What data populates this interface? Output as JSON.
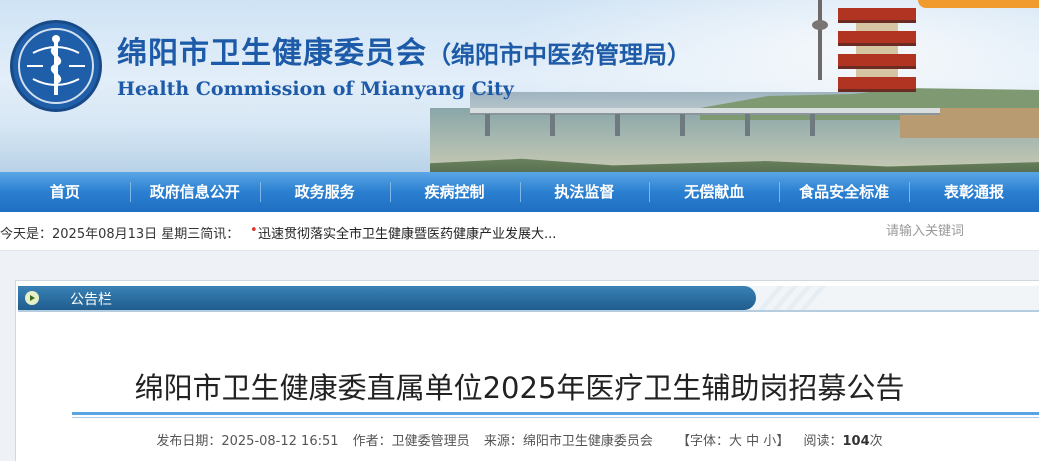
{
  "header": {
    "title_cn": "绵阳市卫生健康委员会",
    "title_cn_sub": "（绵阳市中医药管理局）",
    "title_en": "Health Commission of Mianyang City"
  },
  "nav": {
    "items": [
      {
        "label": "首页"
      },
      {
        "label": "政府信息公开"
      },
      {
        "label": "政务服务"
      },
      {
        "label": "疾病控制"
      },
      {
        "label": "执法监督"
      },
      {
        "label": "无偿献血"
      },
      {
        "label": "食品安全标准"
      },
      {
        "label": "表彰通报"
      }
    ]
  },
  "info_bar": {
    "today": "今天是：2025年08月13日 星期三简讯：",
    "bullet": "•",
    "news": "迅速贯彻落实全市卫生健康暨医药健康产业发展大..."
  },
  "search": {
    "placeholder": "请输入关键词"
  },
  "notice": {
    "label": "公告栏"
  },
  "article": {
    "title": "绵阳市卫生健康委直属单位2025年医疗卫生辅助岗招募公告",
    "meta": {
      "date_label": "发布日期：2025-08-12 16:51",
      "author_label": "作者：卫健委管理员",
      "source_label": "来源：绵阳市卫生健康委员会",
      "font_label": "【字体：",
      "font_large": "大",
      "font_medium": "中",
      "font_small": "小",
      "font_end": "】",
      "views_label": "阅读：",
      "views_count": "104",
      "views_unit": "次"
    }
  },
  "colors": {
    "brand_blue": "#1d5aa7",
    "nav_blue": "#2b7fd0",
    "notice_bar": "#1f5d8e",
    "title_rule": "#59a5e3",
    "accent_orange": "#f19a2d"
  }
}
